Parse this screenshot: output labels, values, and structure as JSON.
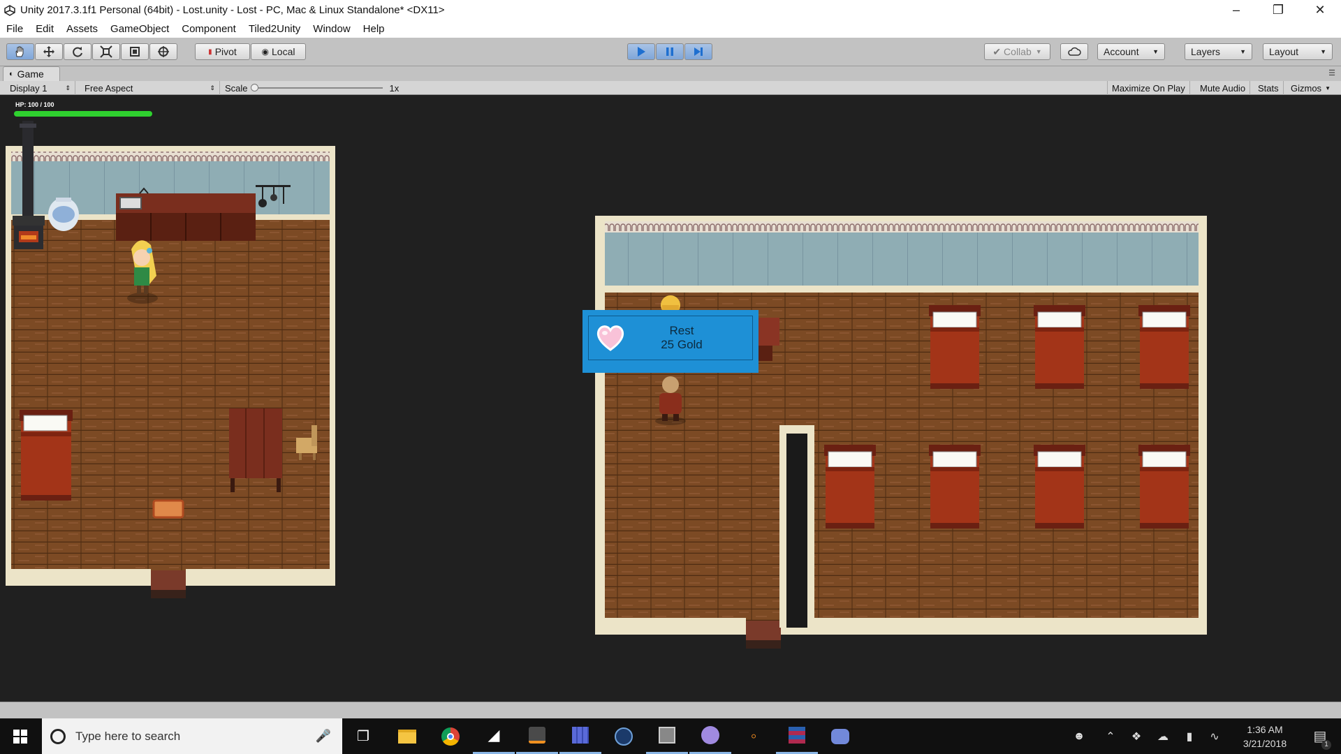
{
  "window": {
    "title": "Unity 2017.3.1f1 Personal (64bit) - Lost.unity - Lost - PC, Mac & Linux Standalone* <DX11>"
  },
  "menu": [
    "File",
    "Edit",
    "Assets",
    "GameObject",
    "Component",
    "Tiled2Unity",
    "Window",
    "Help"
  ],
  "toolbar": {
    "pivot_label": "Pivot",
    "local_label": "Local",
    "collab_label": "Collab",
    "account_label": "Account",
    "layers_label": "Layers",
    "layout_label": "Layout"
  },
  "game_tab": {
    "label": "Game"
  },
  "game_bar": {
    "display": "Display 1",
    "aspect": "Free Aspect",
    "scale_label": "Scale",
    "scale_value": "1x",
    "maximize_label": "Maximize On Play",
    "mute_label": "Mute Audio",
    "stats_label": "Stats",
    "gizmos_label": "Gizmos"
  },
  "hud": {
    "hp_text": "HP: 100 / 100",
    "hp_fraction": 1.0,
    "hp_color": "#2fd12f"
  },
  "rest_dialog": {
    "line1": "Rest",
    "line2": "25 Gold",
    "bg_color": "#1e90d6"
  },
  "taskbar": {
    "search_placeholder": "Type here to search",
    "time": "1:36 AM",
    "date": "3/21/2018",
    "notification_count": "1"
  }
}
